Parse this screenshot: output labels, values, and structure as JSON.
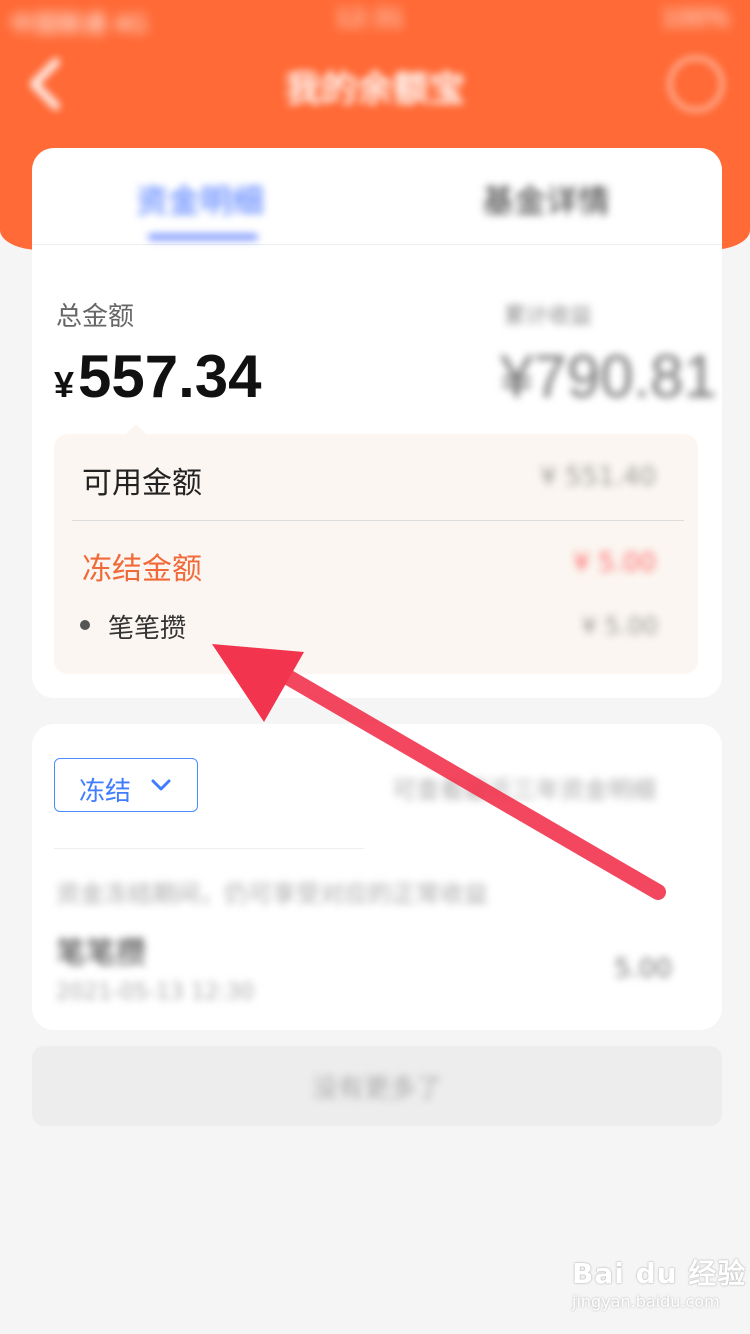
{
  "status_bar": {
    "carrier": "中国联通 4G",
    "time": "12:31",
    "battery": "100%"
  },
  "header": {
    "title": "我的余额宝"
  },
  "tabs": [
    {
      "label": "资金明细"
    },
    {
      "label": "基金详情"
    }
  ],
  "summary": {
    "total_label": "总金额",
    "currency_symbol": "¥",
    "total_amount": "557.34",
    "cumulative_label": "累计收益",
    "cumulative_amount": "¥790.81"
  },
  "details": {
    "available_label": "可用金额",
    "available_amount": "¥ 551.40",
    "frozen_label": "冻结金额",
    "frozen_amount": "¥ 5.00",
    "sub_item_label": "笔笔攒",
    "sub_item_amount": "¥ 5.00"
  },
  "records": {
    "filter_label": "冻结",
    "hint": "可查看最近三年资金明细",
    "notice": "资金冻结期间，仍可享受对应的正常收益",
    "record_title": "笔笔攒",
    "record_time": "2021-05-13 12:30",
    "record_amount": "5.00"
  },
  "footer": {
    "no_more": "没有更多了"
  },
  "watermark": {
    "main": "Bai du 经验",
    "sub": "jingyan.baidu.com"
  },
  "colors": {
    "header": "#ff6a36",
    "frozen": "#f06a3a",
    "accent_blue": "#3f7cff",
    "arrow": "#f2344e"
  }
}
